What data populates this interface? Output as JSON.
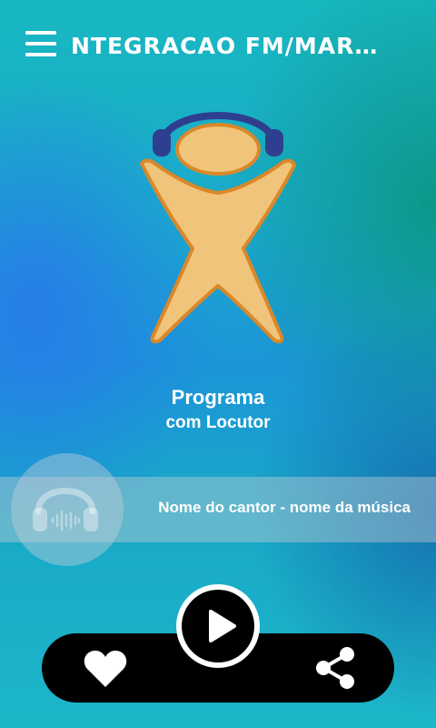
{
  "app_bar": {
    "title": "NTEGRACAO FM/MARQU..",
    "menu_icon": "hamburger-menu-icon"
  },
  "logo": {
    "icon": "mascot-headphones-logo"
  },
  "program": {
    "title": "Programa",
    "subtitle": "com Locutor"
  },
  "now_playing": {
    "artwork_icon": "headphones-icon",
    "track": "Nome do cantor - nome da música"
  },
  "controls": {
    "favorite_icon": "heart-icon",
    "play_icon": "play-icon",
    "share_icon": "share-icon"
  },
  "colors": {
    "logo_fill": "#f0c47a",
    "logo_outline": "#d9882a",
    "headphones": "#2f3f8f",
    "bar": "#000000",
    "text": "#ffffff"
  }
}
